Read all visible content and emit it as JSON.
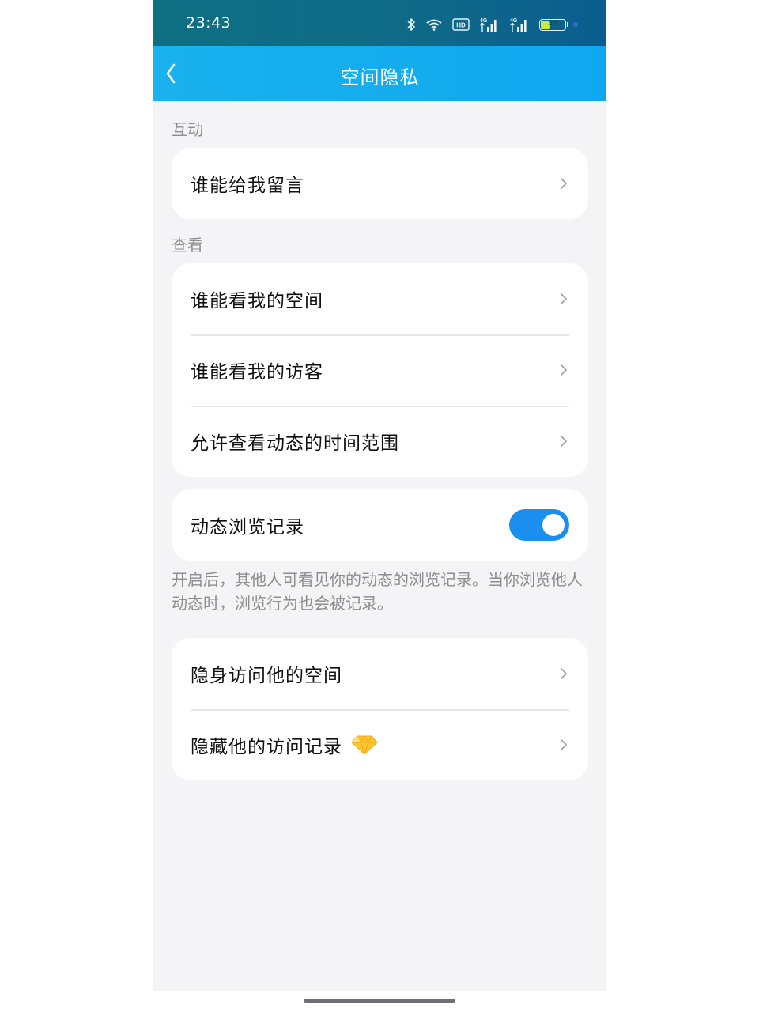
{
  "status_bar": {
    "time": "23:43",
    "battery_level": "45",
    "battery_fraction": 0.45,
    "icons": [
      "bluetooth-icon",
      "wifi-icon",
      "hd-voice-icon",
      "signal-4g-icon",
      "signal-4g-icon",
      "battery-icon"
    ]
  },
  "nav": {
    "back_icon": "chevron-left-icon",
    "title": "空间隐私"
  },
  "sections": {
    "interaction": {
      "label": "互动",
      "items": [
        {
          "label": "谁能给我留言"
        }
      ]
    },
    "view": {
      "label": "查看",
      "items": [
        {
          "label": "谁能看我的空间"
        },
        {
          "label": "谁能看我的访客"
        },
        {
          "label": "允许查看动态的时间范围"
        }
      ]
    },
    "browse_record": {
      "label": "动态浏览记录",
      "toggle_on": true,
      "hint": "开启后，其他人可看见你的动态的浏览记录。当你浏览他人动态时，浏览行为也会被记录。"
    },
    "stealth": {
      "items": [
        {
          "label": "隐身访问他的空间"
        },
        {
          "label": "隐藏他的访问记录",
          "badge_icon": "diamond-vip-icon"
        }
      ]
    }
  },
  "colors": {
    "status_bar": "#0e6f83",
    "nav_bar": "#19b2ee",
    "toggle_on": "#1a8ff0",
    "page_bg": "#f4f4f6"
  }
}
